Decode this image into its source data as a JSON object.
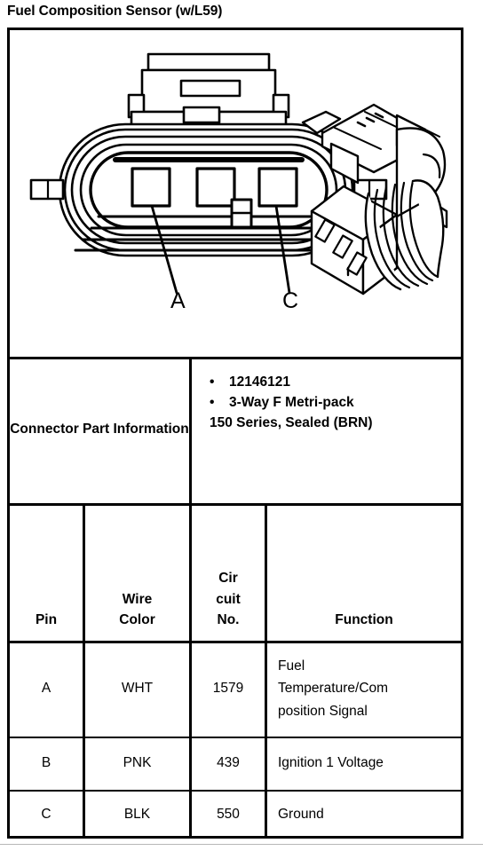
{
  "page": {
    "title": "Fuel Composition Sensor (w/L59)"
  },
  "diagram": {
    "callouts": [
      {
        "label": "A",
        "terminal": "left"
      },
      {
        "label": "C",
        "terminal": "right"
      }
    ],
    "views": [
      "connector-front-view",
      "connector-isometric-view"
    ],
    "cavity_count": 3
  },
  "connector_part_information": {
    "label": "Connector Part Information",
    "bullets": [
      "12146121",
      "3-Way F Metri-pack"
    ],
    "continuation": "150 Series, Sealed (BRN)"
  },
  "pin_table": {
    "headers": {
      "pin": "Pin",
      "wire_color_line1": "Wire",
      "wire_color_line2": "Color",
      "circuit_no_line1": "Cir",
      "circuit_no_line2": "cuit",
      "circuit_no_line3": "No.",
      "function": "Function"
    },
    "rows": [
      {
        "pin": "A",
        "wire_color": "WHT",
        "circuit_no": "1579",
        "function_line1": "Fuel",
        "function_line2": "Temperature/Com",
        "function_line3": "position Signal"
      },
      {
        "pin": "B",
        "wire_color": "PNK",
        "circuit_no": "439",
        "function_line1": "Ignition 1 Voltage",
        "function_line2": "",
        "function_line3": ""
      },
      {
        "pin": "C",
        "wire_color": "BLK",
        "circuit_no": "550",
        "function_line1": "Ground",
        "function_line2": "",
        "function_line3": ""
      }
    ]
  },
  "colors": {
    "ink": "#000000",
    "paper": "#ffffff",
    "page_rule": "#b8b8b8"
  }
}
